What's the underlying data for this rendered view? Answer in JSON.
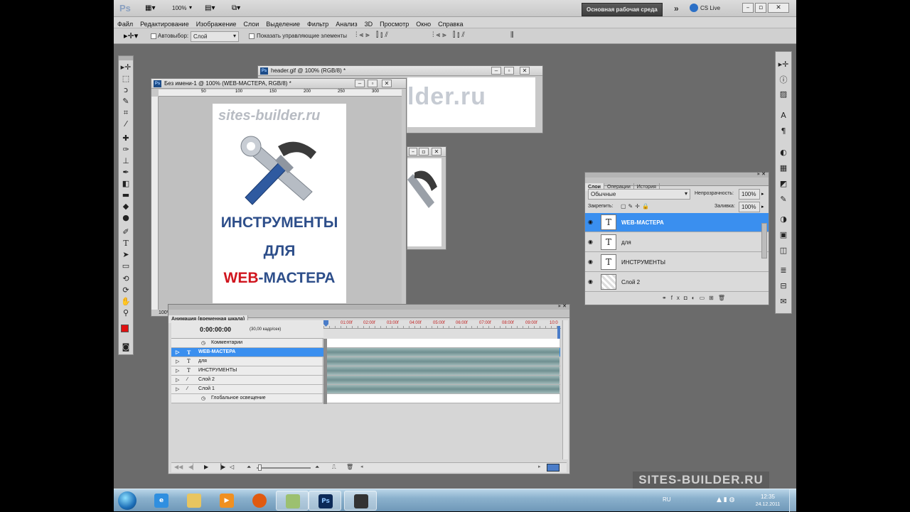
{
  "app": {
    "logo": "Ps",
    "zoom": "100%",
    "workspace": "Основная рабочая среда",
    "cslive": "CS Live",
    "overflow": "»"
  },
  "menu": [
    "Файл",
    "Редактирование",
    "Изображение",
    "Слои",
    "Выделение",
    "Фильтр",
    "Анализ",
    "3D",
    "Просмотр",
    "Окно",
    "Справка"
  ],
  "options": {
    "autoselect_label": "Автовыбор:",
    "autoselect_value": "Слой",
    "show_controls_label": "Показать управляющие элементы"
  },
  "windows": {
    "header_title": "header.gif @ 100% (RGB/8) *",
    "header_logo": "lder.ru",
    "main_title": "Без имени-1 @ 100% (WEB-МАСТЕРА, RGB/8) *",
    "main_zoom": "100%",
    "ruler_marks": [
      "50",
      "100",
      "150",
      "200",
      "250",
      "300"
    ]
  },
  "poster": {
    "brand": "sites-builder.ru",
    "line1": "ИНСТРУМЕНТЫ",
    "line2": "ДЛЯ",
    "line3_red": "WEB",
    "line3_blue": "-МАСТЕРА",
    "colors": {
      "blue": "#2d4e8a",
      "red": "#d0151e"
    }
  },
  "layers_panel": {
    "tabs": [
      "Слои",
      "Операции",
      "История"
    ],
    "blend_mode": "Обычные",
    "opacity_label": "Непрозрачность:",
    "opacity_value": "100%",
    "lock_label": "Закрепить:",
    "fill_label": "Заливка:",
    "fill_value": "100%",
    "layers": [
      {
        "name": "WEB-МАСТЕРА",
        "thumb": "T",
        "selected": true
      },
      {
        "name": "для",
        "thumb": "T",
        "selected": false
      },
      {
        "name": "ИНСТРУМЕНТЫ",
        "thumb": "T",
        "selected": false
      },
      {
        "name": "Слой 2",
        "thumb": "",
        "selected": false
      }
    ]
  },
  "timeline": {
    "title": "Анимация (временная шкала)",
    "timecode": "0:00:00:00",
    "fps": "(30,00 кадр/сек)",
    "ticks": [
      "01:00f",
      "02:00f",
      "03:00f",
      "04:00f",
      "05:00f",
      "06:00f",
      "07:00f",
      "08:00f",
      "09:00f",
      "10:0"
    ],
    "rows": [
      {
        "name": "Комментарии",
        "kind": "meta"
      },
      {
        "name": "WEB-МАСТЕРА",
        "kind": "text",
        "selected": true
      },
      {
        "name": "для",
        "kind": "text"
      },
      {
        "name": "ИНСТРУМЕНТЫ",
        "kind": "text"
      },
      {
        "name": "Слой 2",
        "kind": "brush"
      },
      {
        "name": "Слой 1",
        "kind": "brush"
      },
      {
        "name": "Глобальное освещение",
        "kind": "meta"
      }
    ]
  },
  "watermark": "SITES-BUILDER.RU",
  "tray": {
    "lang": "RU",
    "time": "12:35",
    "date": "24.12.2011"
  }
}
